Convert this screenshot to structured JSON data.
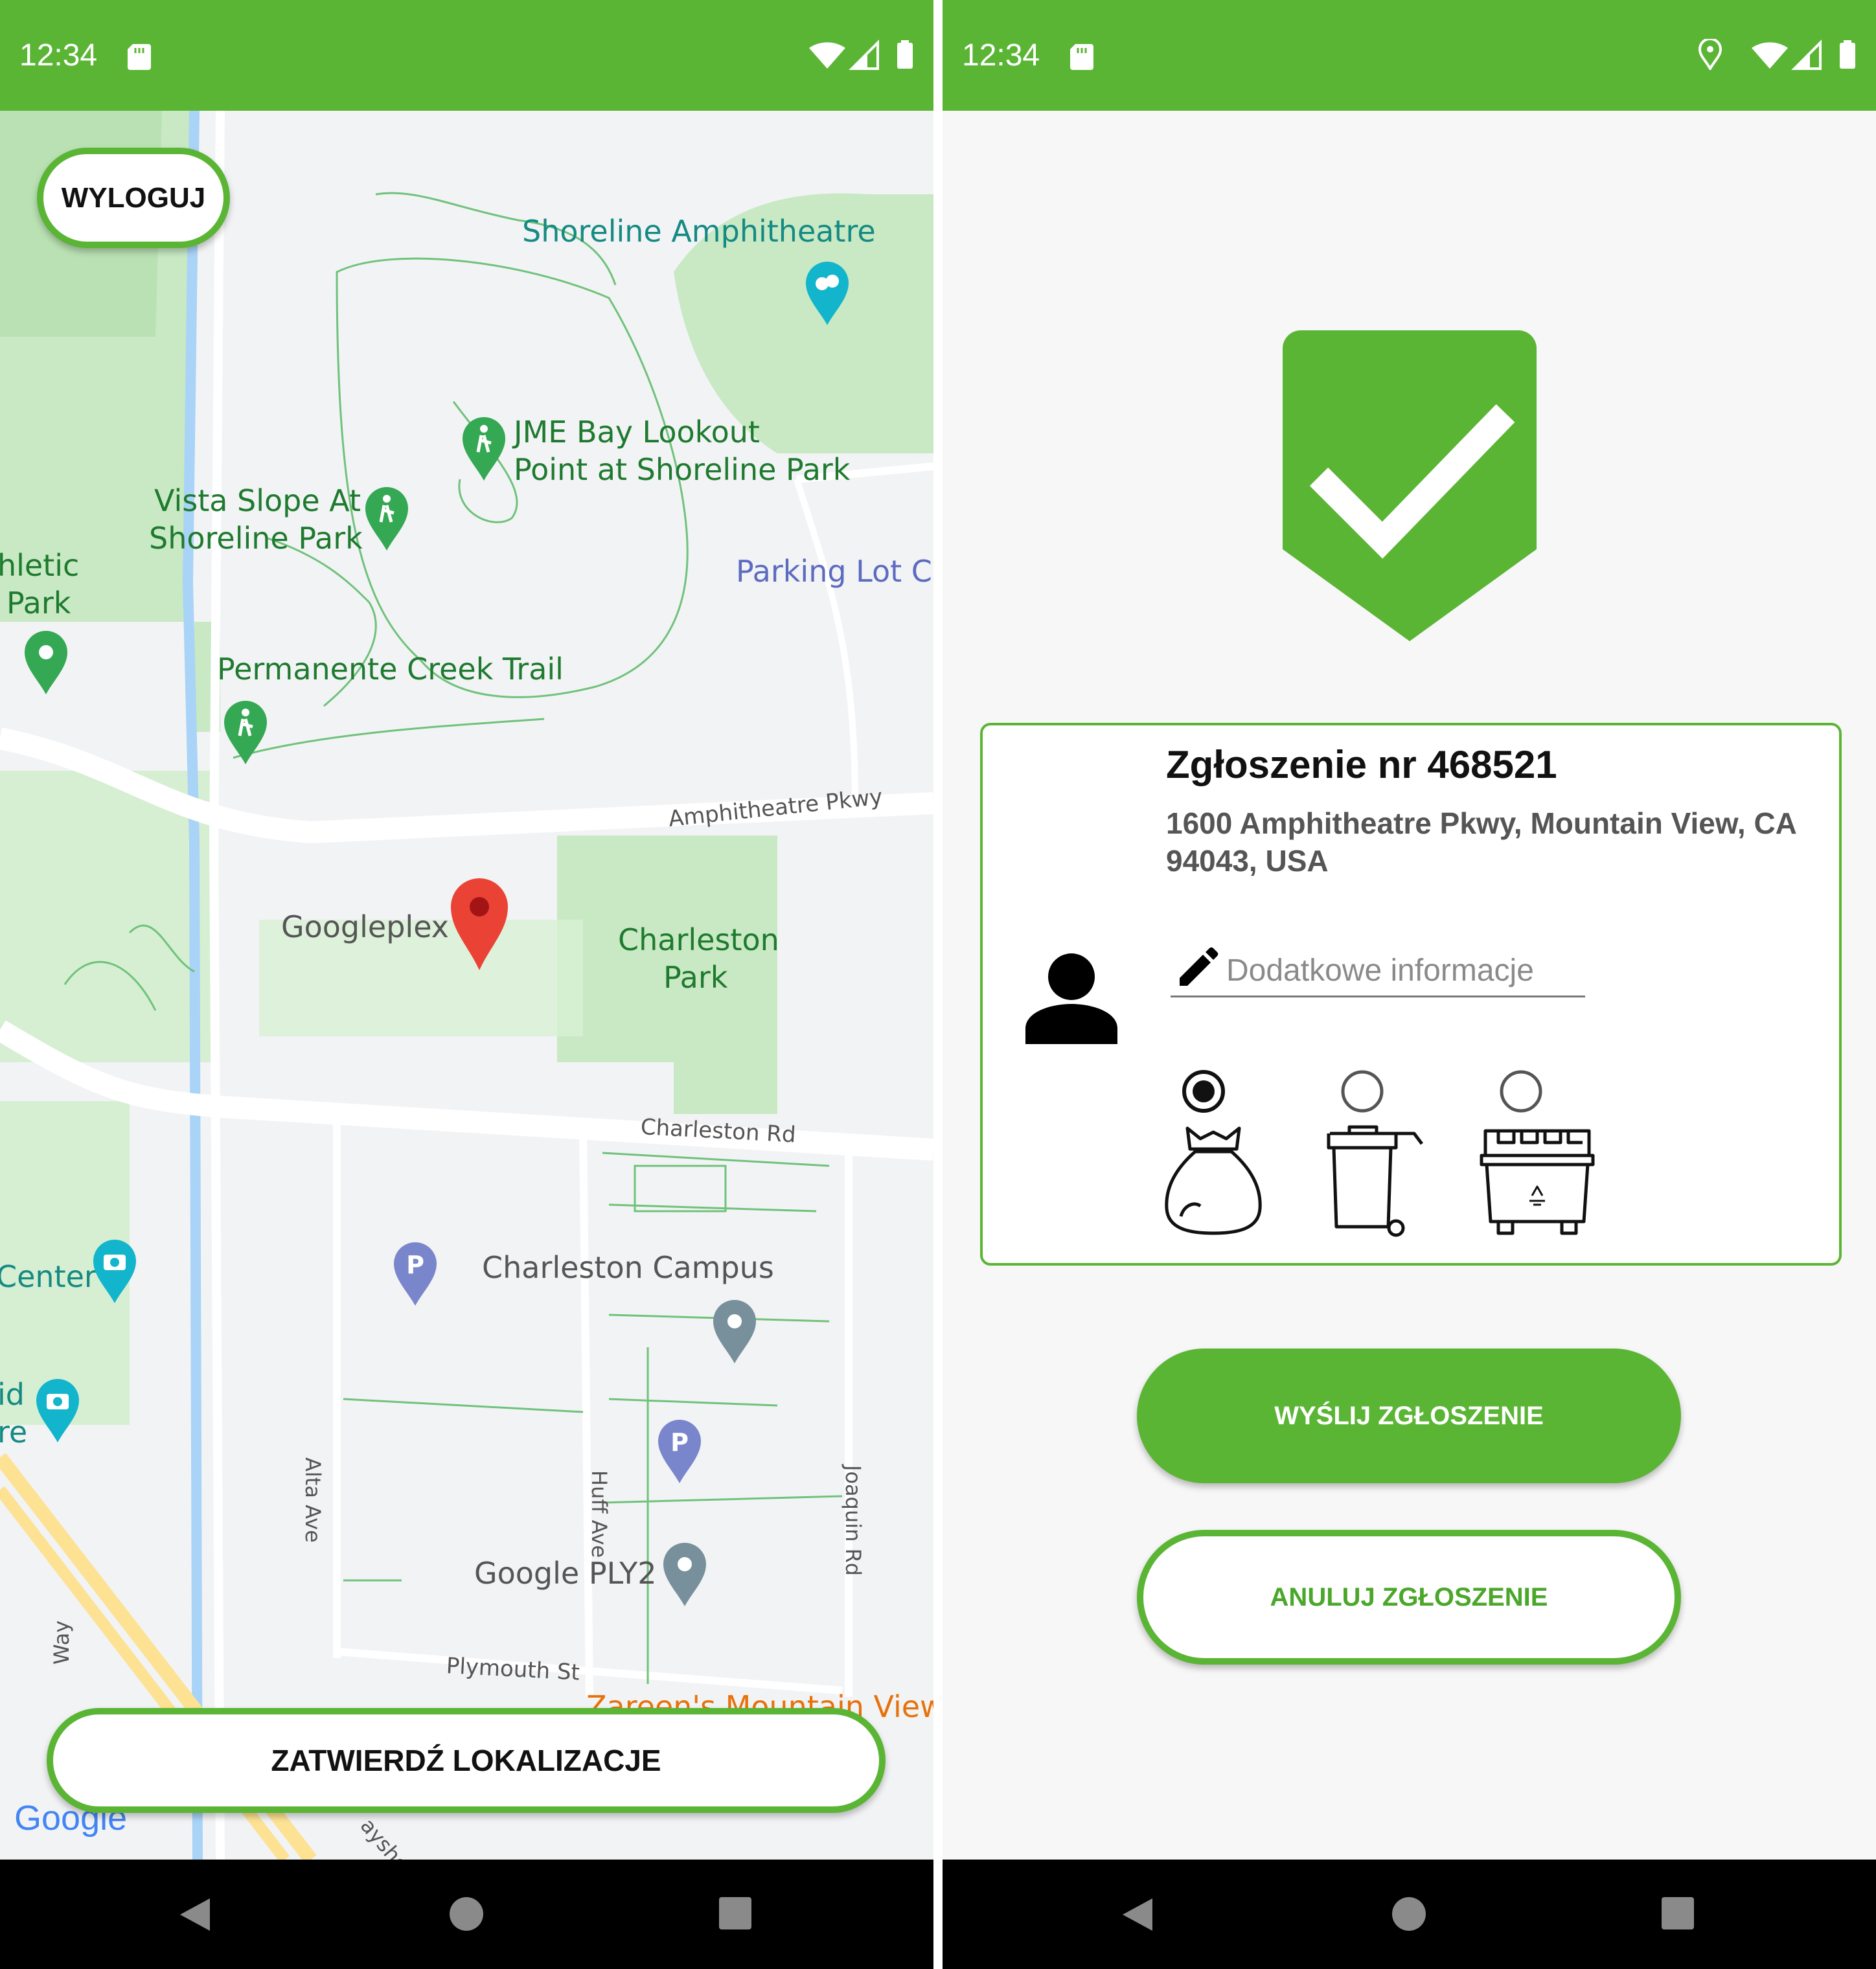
{
  "status_bar": {
    "time": "12:34"
  },
  "map_screen": {
    "logout_label": "WYLOGUJ",
    "confirm_label": "ZATWIERDŹ LOKALIZACJE",
    "map_labels": {
      "shoreline_amphitheatre": "Shoreline Amphitheatre",
      "jme_line1": "JME Bay Lookout",
      "jme_line2": "Point at Shoreline Park",
      "vista_line1": "Vista Slope At",
      "vista_line2": "Shoreline Park",
      "athletic_line1": "hletic",
      "athletic_line2": "Park",
      "parking_lot_c": "Parking Lot C",
      "permanente": "Permanente Creek Trail",
      "amphitheatre_pkwy": "Amphitheatre Pkwy",
      "googleplex": "Googleplex",
      "charleston_park_line1": "Charleston",
      "charleston_park_line2": "Park",
      "charleston_rd": "Charleston Rd",
      "center": "Center",
      "id_fragment": "id",
      "re_fragment": "re",
      "charleston_campus": "Charleston Campus",
      "alta_ave": "Alta Ave",
      "huff_ave": "Huff Ave",
      "joaquin_rd": "Joaquin Rd",
      "google_ply2": "Google PLY2",
      "plymouth_st": "Plymouth St",
      "zareens": "Zareen's Mountain View",
      "way": "Way",
      "bayshore": "ayshore",
      "google_logo": "Google"
    }
  },
  "report_screen": {
    "title": "Zgłoszenie nr 468521",
    "address": "1600 Amphitheatre Pkwy, Mountain View, CA 94043, USA",
    "info_placeholder": "Dodatkowe informacje",
    "info_value": "",
    "bin_options": [
      {
        "name": "trash-bag",
        "selected": true
      },
      {
        "name": "wheelie-bin",
        "selected": false
      },
      {
        "name": "recycling-container",
        "selected": false
      }
    ],
    "send_label": "WYŚLIJ ZGŁOSZENIE",
    "cancel_label": "ANULUJ ZGŁOSZENIE"
  },
  "colors": {
    "accent": "#5bb535",
    "map_bg": "#f2f3f5",
    "park": "#c8e9c4",
    "road": "#ffffff",
    "water": "#a9d3f7",
    "route": "#fde293"
  },
  "icons": [
    "sd-card-icon",
    "wifi-icon",
    "signal-icon",
    "battery-icon",
    "location-icon",
    "back-icon",
    "home-icon",
    "recents-icon",
    "map-pin-icon",
    "hiking-icon",
    "theater-icon",
    "parking-icon",
    "camera-icon",
    "pencil-icon",
    "person-icon",
    "shield-check-icon",
    "trash-bag-icon",
    "wheelie-bin-icon",
    "recycling-container-icon"
  ]
}
